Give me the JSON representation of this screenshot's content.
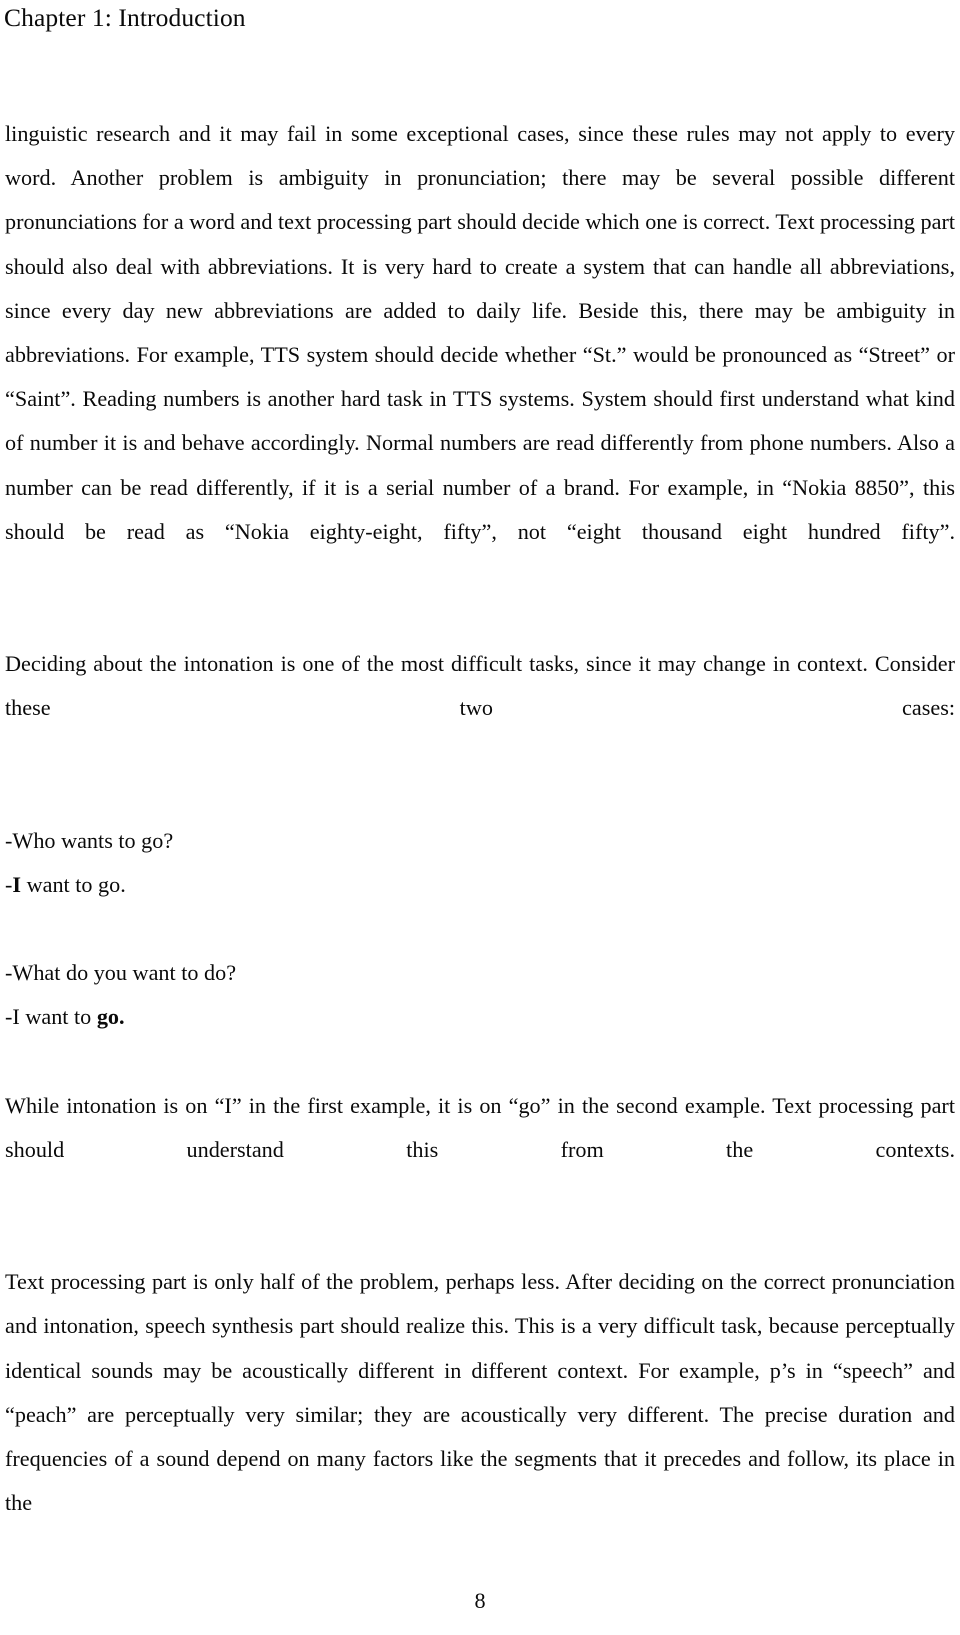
{
  "header": {
    "running_head": "Chapter 1: Introduction"
  },
  "body": {
    "paragraph_1": "linguistic research and it may fail in some exceptional cases, since these rules may not apply to every word. Another problem is ambiguity in pronunciation; there may be several possible different pronunciations for a word and text processing part should decide which one is correct. Text processing part should also deal with abbreviations. It is very hard to create a system that can handle all abbreviations, since every day new abbreviations are added to daily life. Beside this, there may be ambiguity in abbreviations. For example, TTS system should decide whether “St.” would be pronounced as “Street” or “Saint”. Reading numbers is another hard task in TTS systems. System should first understand what kind of number it is and behave accordingly. Normal numbers are read differently from phone numbers. Also a number can be read differently, if it is a serial number of a brand. For example, in “Nokia 8850”, this should be read as “Nokia eighty-eight, fifty”, not “eight thousand eight hundred fifty”.",
    "paragraph_2": "Deciding about the intonation is one of the most difficult tasks, since it may change in context. Consider these two cases:",
    "dialogue_1": {
      "question": "-Who wants to go?",
      "answer_prefix": "-",
      "answer_emphasis": "I",
      "answer_rest": " want to go."
    },
    "dialogue_2": {
      "question": "-What do you want to do?",
      "answer_prefix": "-I want to ",
      "answer_emphasis": "go.",
      "answer_rest": ""
    },
    "paragraph_3": "While intonation is on “I” in the first example, it is on “go” in the second example. Text processing part should understand this from the contexts.",
    "paragraph_4": "Text processing part is only half of the problem, perhaps less. After deciding on the correct pronunciation and intonation, speech synthesis part should realize this. This is a very difficult task, because perceptually identical sounds may be acoustically different in different context. For example, p’s in “speech” and “peach” are perceptually very similar; they are acoustically very different. The precise duration and frequencies of a sound depend on many factors like the segments that it precedes and follow, its place in the"
  },
  "footer": {
    "page_number": "8"
  }
}
